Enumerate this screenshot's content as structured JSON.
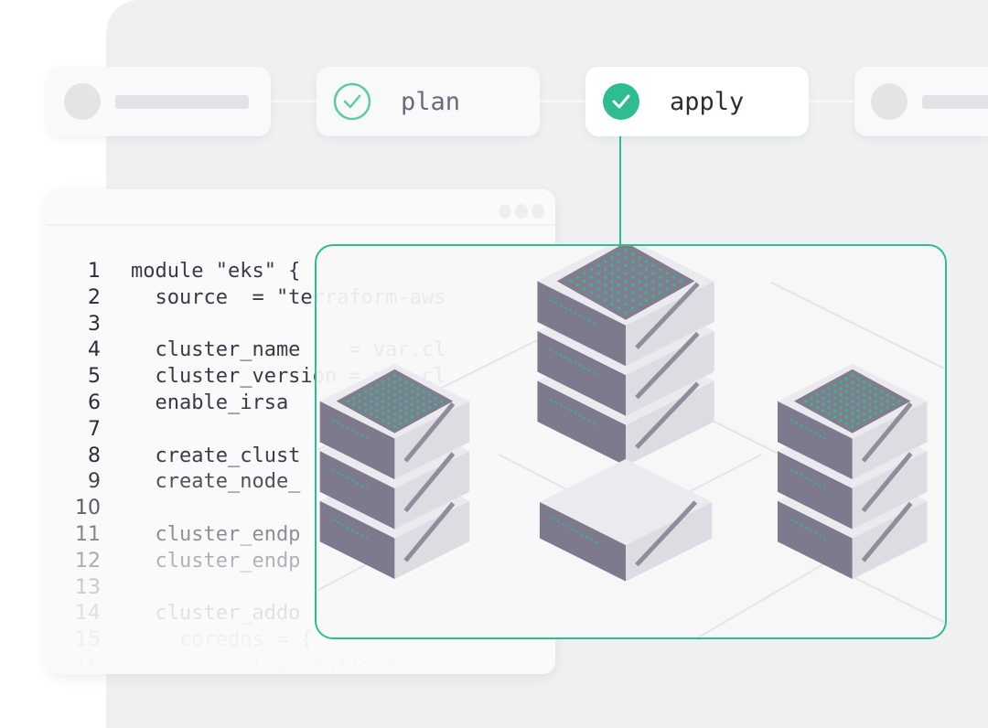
{
  "pipeline": {
    "steps": [
      {
        "label": "",
        "status": "pending"
      },
      {
        "label": "plan",
        "status": "completed",
        "icon": "check-circle-outline-icon"
      },
      {
        "label": "apply",
        "status": "active",
        "icon": "check-circle-filled-icon"
      },
      {
        "label": "",
        "status": "pending"
      }
    ]
  },
  "editor": {
    "lines": [
      {
        "n": "1",
        "text": "module \"eks\" {"
      },
      {
        "n": "2",
        "text": "  source  = \"terraform-aws"
      },
      {
        "n": "3",
        "text": ""
      },
      {
        "n": "4",
        "text": "  cluster_name    = var.cl"
      },
      {
        "n": "5",
        "text": "  cluster_version = var.cl"
      },
      {
        "n": "6",
        "text": "  enable_irsa"
      },
      {
        "n": "7",
        "text": ""
      },
      {
        "n": "8",
        "text": "  create_clust"
      },
      {
        "n": "9",
        "text": "  create_node_"
      },
      {
        "n": "10",
        "text": ""
      },
      {
        "n": "11",
        "text": "  cluster_endp"
      },
      {
        "n": "12",
        "text": "  cluster_endp"
      },
      {
        "n": "13",
        "text": ""
      },
      {
        "n": "14",
        "text": "  cluster_addo"
      },
      {
        "n": "15",
        "text": "    coredns = {"
      },
      {
        "n": "16",
        "text": "      resolve_conflicts"
      }
    ]
  },
  "colors": {
    "accent": "#2fbc91",
    "server": "#8a8898",
    "background": "#eef0f2"
  }
}
